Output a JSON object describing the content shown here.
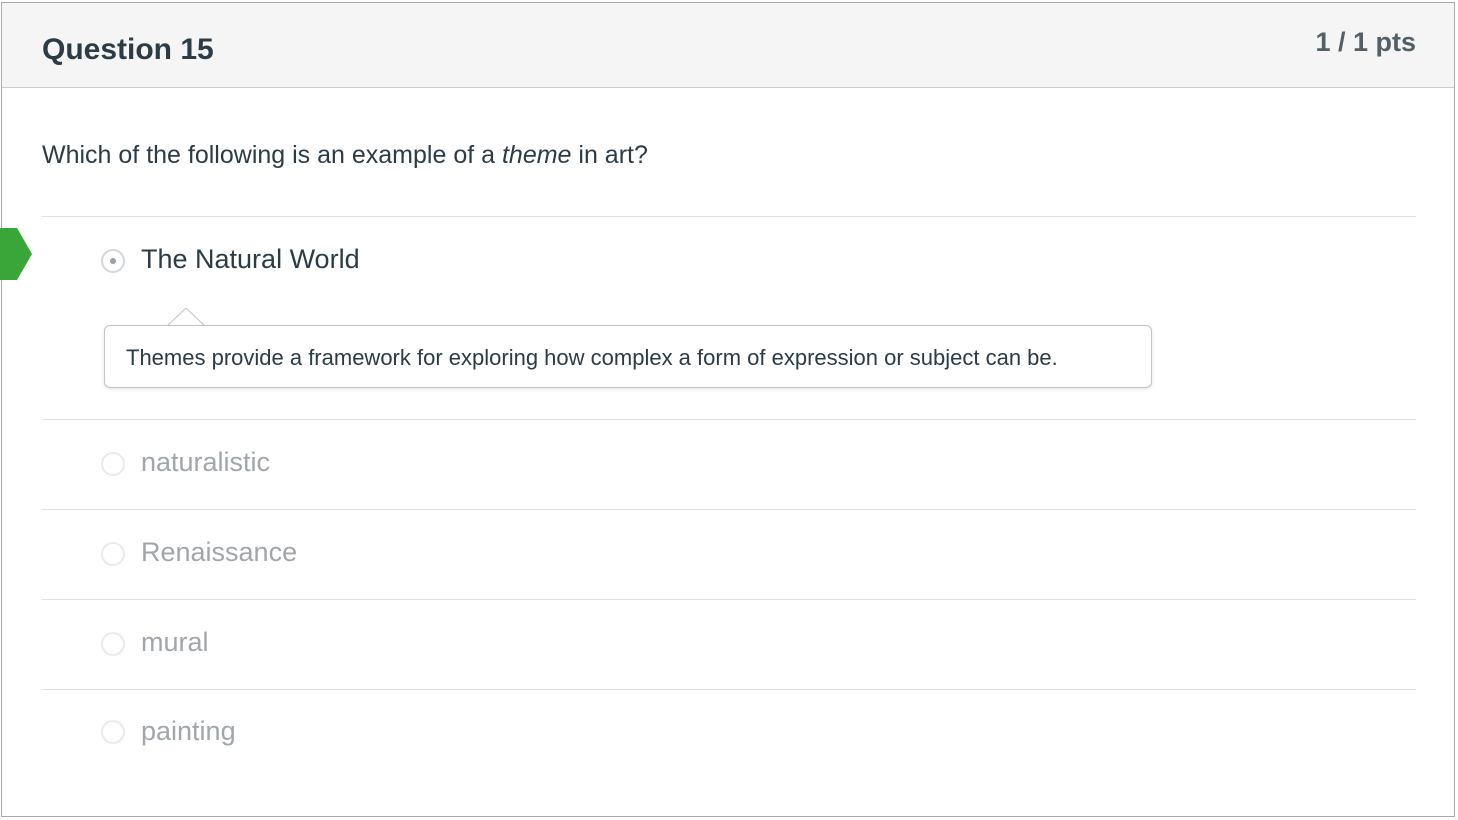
{
  "question": {
    "title": "Question 15",
    "points": "1 / 1 pts",
    "text_before": "Which of the following is an example of a ",
    "text_emphasis": "theme",
    "text_after": " in art?"
  },
  "answers": [
    {
      "label": "The Natural World",
      "selected": true,
      "correct": true
    },
    {
      "label": "naturalistic",
      "selected": false,
      "correct": false
    },
    {
      "label": "Renaissance",
      "selected": false,
      "correct": false
    },
    {
      "label": "mural",
      "selected": false,
      "correct": false
    },
    {
      "label": "painting",
      "selected": false,
      "correct": false
    }
  ],
  "comment": {
    "text": "Themes provide a framework for exploring how complex a form of expression or subject can be."
  },
  "colors": {
    "correct_marker": "#3aa63a",
    "header_bg": "#f5f5f5",
    "text": "#2d3b45",
    "muted_text": "#a1a6ab"
  },
  "icons": {
    "correct_marker": "correct-answer-arrow-icon"
  }
}
